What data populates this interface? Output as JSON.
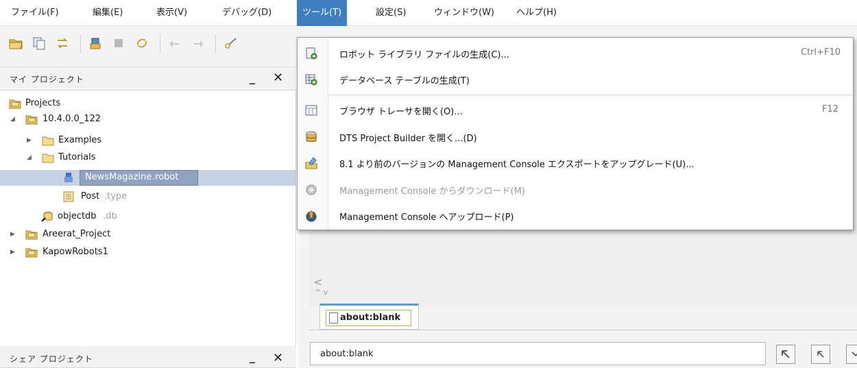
{
  "menubar": {
    "items": [
      {
        "label": "ファイル(F)"
      },
      {
        "label": "編集(E)"
      },
      {
        "label": "表示(V)"
      },
      {
        "label": "デバッグ(D)"
      },
      {
        "label": "ツール(T)"
      },
      {
        "label": "設定(S)"
      },
      {
        "label": "ウィンドウ(W)"
      },
      {
        "label": "ヘルプ(H)"
      }
    ],
    "active_index": 4
  },
  "toolbar": {
    "icons": [
      "open-folder-icon",
      "copy-icon",
      "compare-icon",
      "robot-icon",
      "stop-icon",
      "refresh-icon",
      "back-icon",
      "forward-icon",
      "cut-icon"
    ]
  },
  "my_projects": {
    "title": "マイ プロジェクト",
    "minimize": "_",
    "close": "✕",
    "tree": [
      {
        "label": "Projects",
        "ext": "",
        "icon": "project-folder-icon"
      },
      {
        "label": "10.4.0.0_122",
        "ext": "",
        "icon": "project-folder-icon"
      },
      {
        "label": "Examples",
        "ext": "",
        "icon": "folder-icon"
      },
      {
        "label": "Tutorials",
        "ext": "",
        "icon": "folder-icon"
      },
      {
        "label": "NewsMagazine",
        "ext": ".robot",
        "icon": "robot-file-icon"
      },
      {
        "label": "Post",
        "ext": ".type",
        "icon": "type-file-icon"
      },
      {
        "label": "objectdb",
        "ext": ".db",
        "icon": "database-icon"
      },
      {
        "label": "Areerat_Project",
        "ext": "",
        "icon": "project-folder-icon"
      },
      {
        "label": "KapowRobots1",
        "ext": "",
        "icon": "project-folder-icon"
      }
    ]
  },
  "shared_projects": {
    "title": "シェア プロジェクト",
    "minimize": "_",
    "close": "✕"
  },
  "tools_menu": {
    "items": [
      {
        "label": "ロボット ライブラリ ファイルの生成(C)...",
        "shortcut": "Ctrl+F10",
        "icon": "robot-library-icon",
        "enabled": true
      },
      {
        "label": "データベース テーブルの生成(T)",
        "shortcut": "",
        "icon": "database-table-icon",
        "enabled": true
      },
      {
        "label": "ブラウザ トレーサを開く(O)...",
        "shortcut": "F12",
        "icon": "browser-tracer-icon",
        "enabled": true
      },
      {
        "label": "DTS Project Builder を開く...(D)",
        "shortcut": "",
        "icon": "dts-builder-icon",
        "enabled": true
      },
      {
        "label": "8.1 より前のバージョンの Management Console エクスポートをアップグレード(U)...",
        "shortcut": "",
        "icon": "upgrade-icon",
        "enabled": true
      },
      {
        "label": "Management Console からダウンロード(M)",
        "shortcut": "",
        "icon": "download-icon",
        "enabled": false
      },
      {
        "label": "Management Console へアップロード(P)",
        "shortcut": "",
        "icon": "upload-icon",
        "enabled": true
      }
    ]
  },
  "browser": {
    "nav_left": "<",
    "nav_updown": "^ v",
    "tab_label": "about:blank",
    "address_value": "about:blank"
  },
  "colors": {
    "menu_active": "#3f7fbf",
    "tree_selection": "#c6d2e4",
    "tab_accent": "#5b9bd5"
  }
}
